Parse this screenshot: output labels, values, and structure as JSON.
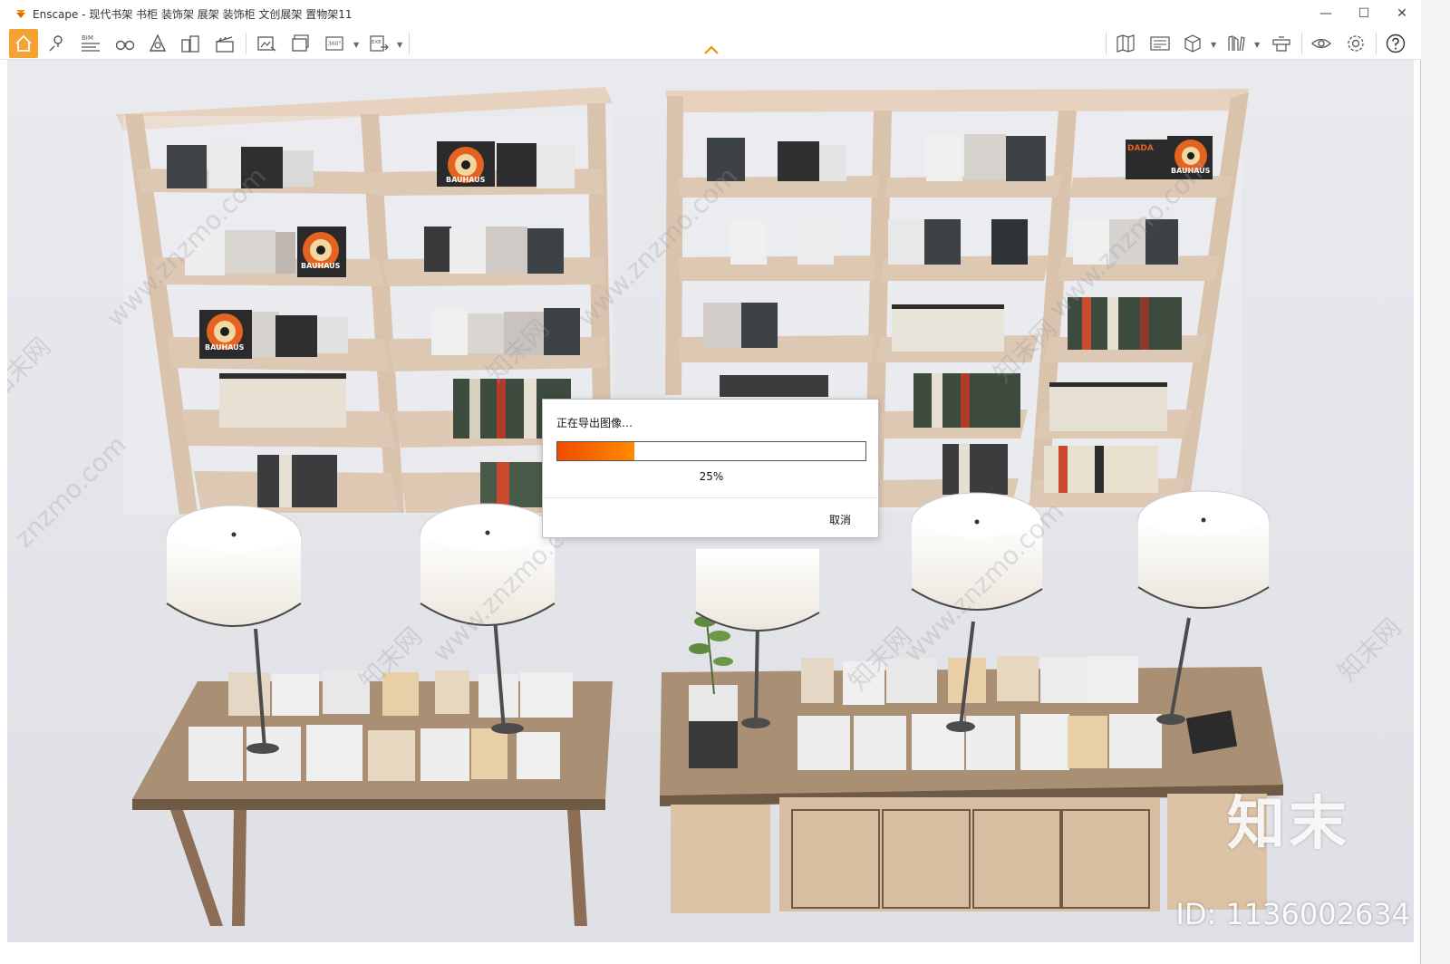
{
  "window": {
    "title": "Enscape - 现代书架 书柜 装饰架 展架 装饰柜 文创展架 置物架11",
    "controls": {
      "minimize": "—",
      "maximize": "☐",
      "close": "✕"
    }
  },
  "toolbar": {
    "left_icons": [
      "home-icon",
      "location-pin-icon",
      "bim-icon",
      "binoculars-icon",
      "assets-icon",
      "buildings-icon",
      "clapper-icon",
      "render-image-icon",
      "batch-render-icon",
      "panorama-360-icon",
      "export-exe-icon"
    ],
    "bim_label": "BIM",
    "pano_label": "360°",
    "exe_label": "EXE",
    "right_icons": [
      "map-icon",
      "views-icon",
      "cube-icon",
      "library-icon",
      "capture-icon",
      "visibility-icon",
      "settings-icon",
      "help-icon"
    ]
  },
  "dialog": {
    "title": "正在导出图像…",
    "progress": 0.25,
    "progress_text": "25%",
    "cancel_label": "取消"
  },
  "watermarks": {
    "site": "www.znzmo.com",
    "site_short": "znzmo.com",
    "cn": "知末网",
    "brand": "知末",
    "id": "ID: 1136002634"
  },
  "scene": {
    "book_labels": [
      "BAUHAUS",
      "DADA"
    ]
  },
  "colors": {
    "accent": "#f6a233",
    "progress_start": "#f04c00",
    "progress_end": "#ff8a00",
    "wood": "#d9c3ad",
    "table_top": "#a98f74"
  }
}
